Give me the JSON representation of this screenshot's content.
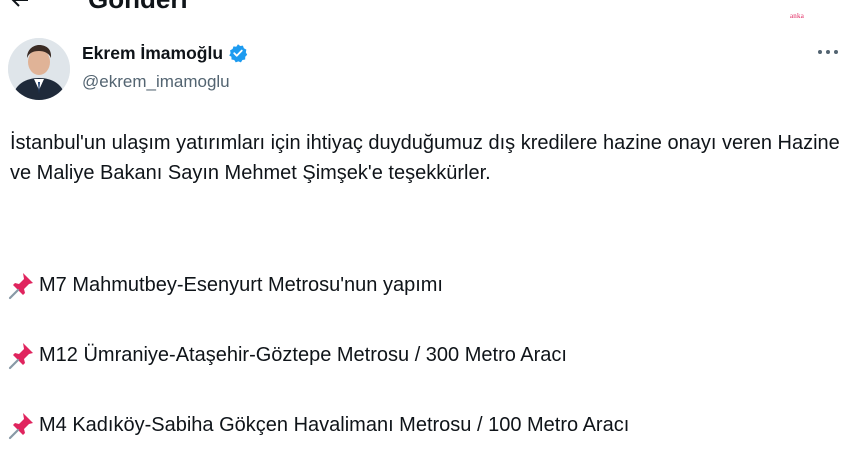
{
  "header": {
    "title": "Gönderi",
    "watermark": "anka"
  },
  "tweet": {
    "author": {
      "display_name": "Ekrem İmamoğlu",
      "handle": "@ekrem_imamoglu",
      "verified": true
    },
    "text_paragraph": "İstanbul'un ulaşım yatırımları için ihtiyaç duyduğumuz dış kredilere hazine onayı veren Hazine ve Maliye Bakanı Sayın Mehmet Şimşek'e teşekkürler.",
    "items": [
      {
        "icon": "pushpin-icon",
        "text": "M7 Mahmutbey-Esenyurt Metrosu'nun yapımı"
      },
      {
        "icon": "pushpin-icon",
        "text": "M12 Ümraniye-Ataşehir-Göztepe Metrosu / 300 Metro Aracı"
      },
      {
        "icon": "pushpin-icon",
        "text": "M4 Kadıköy-Sabiha Gökçen Havalimanı Metrosu / 100 Metro Aracı"
      }
    ]
  },
  "colors": {
    "verified": "#1d9bf0",
    "handle": "#536471",
    "text": "#0f1419",
    "pin": "#e0245e",
    "watermark": "#e0245e"
  }
}
